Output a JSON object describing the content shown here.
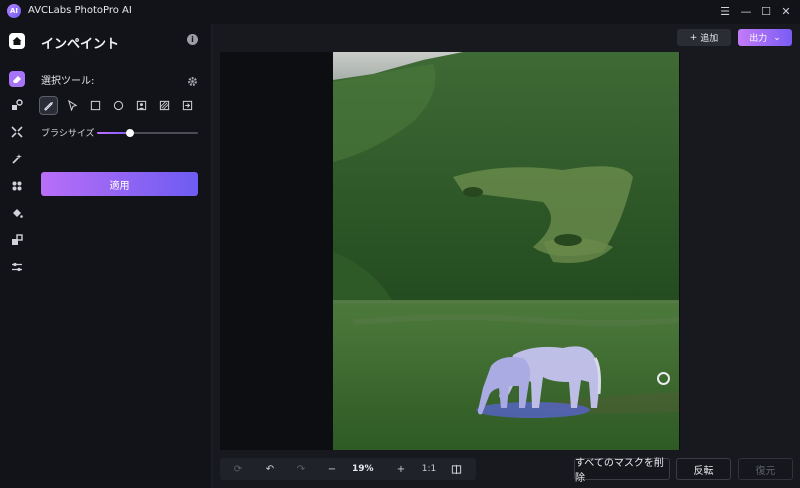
{
  "app": {
    "title": "AVCLabs PhotoPro AI",
    "logo_text": "AI"
  },
  "window_controls": [
    "☰",
    "—",
    "☐",
    "✕"
  ],
  "rail": {
    "items": [
      {
        "name": "home-icon"
      },
      {
        "name": "inpaint-eraser-icon",
        "active": true
      },
      {
        "name": "shapes-icon"
      },
      {
        "name": "expand-icon"
      },
      {
        "name": "magic-wand-icon"
      },
      {
        "name": "object-icon"
      },
      {
        "name": "paint-bucket-icon"
      },
      {
        "name": "crop-icon"
      },
      {
        "name": "adjust-sliders-icon"
      }
    ]
  },
  "panel": {
    "title": "インペイント",
    "selection_tool_label": "選択ツール:",
    "tools": [
      "brush-tool-icon",
      "pointer-tool-icon",
      "rectangle-tool-icon",
      "ellipse-tool-icon",
      "portrait-tool-icon",
      "pattern-tool-icon",
      "import-tool-icon"
    ],
    "brush_size_label": "ブラシサイズ",
    "brush_size_value": 0.33,
    "apply_label": "適用"
  },
  "header": {
    "add_label": "追加",
    "add_icon": "+",
    "export_label": "出力",
    "export_icon": "⌄"
  },
  "zoombar": {
    "zoom_value": "19%",
    "one_to_one": "1:1"
  },
  "bottom": {
    "delete_masks_label": "すべてのマスクを削除",
    "invert_label": "反転",
    "restore_label": "復元"
  },
  "colors": {
    "accent_start": "#b86ef7",
    "accent_end": "#6e5cf2",
    "mask": "#7b7cf6"
  }
}
